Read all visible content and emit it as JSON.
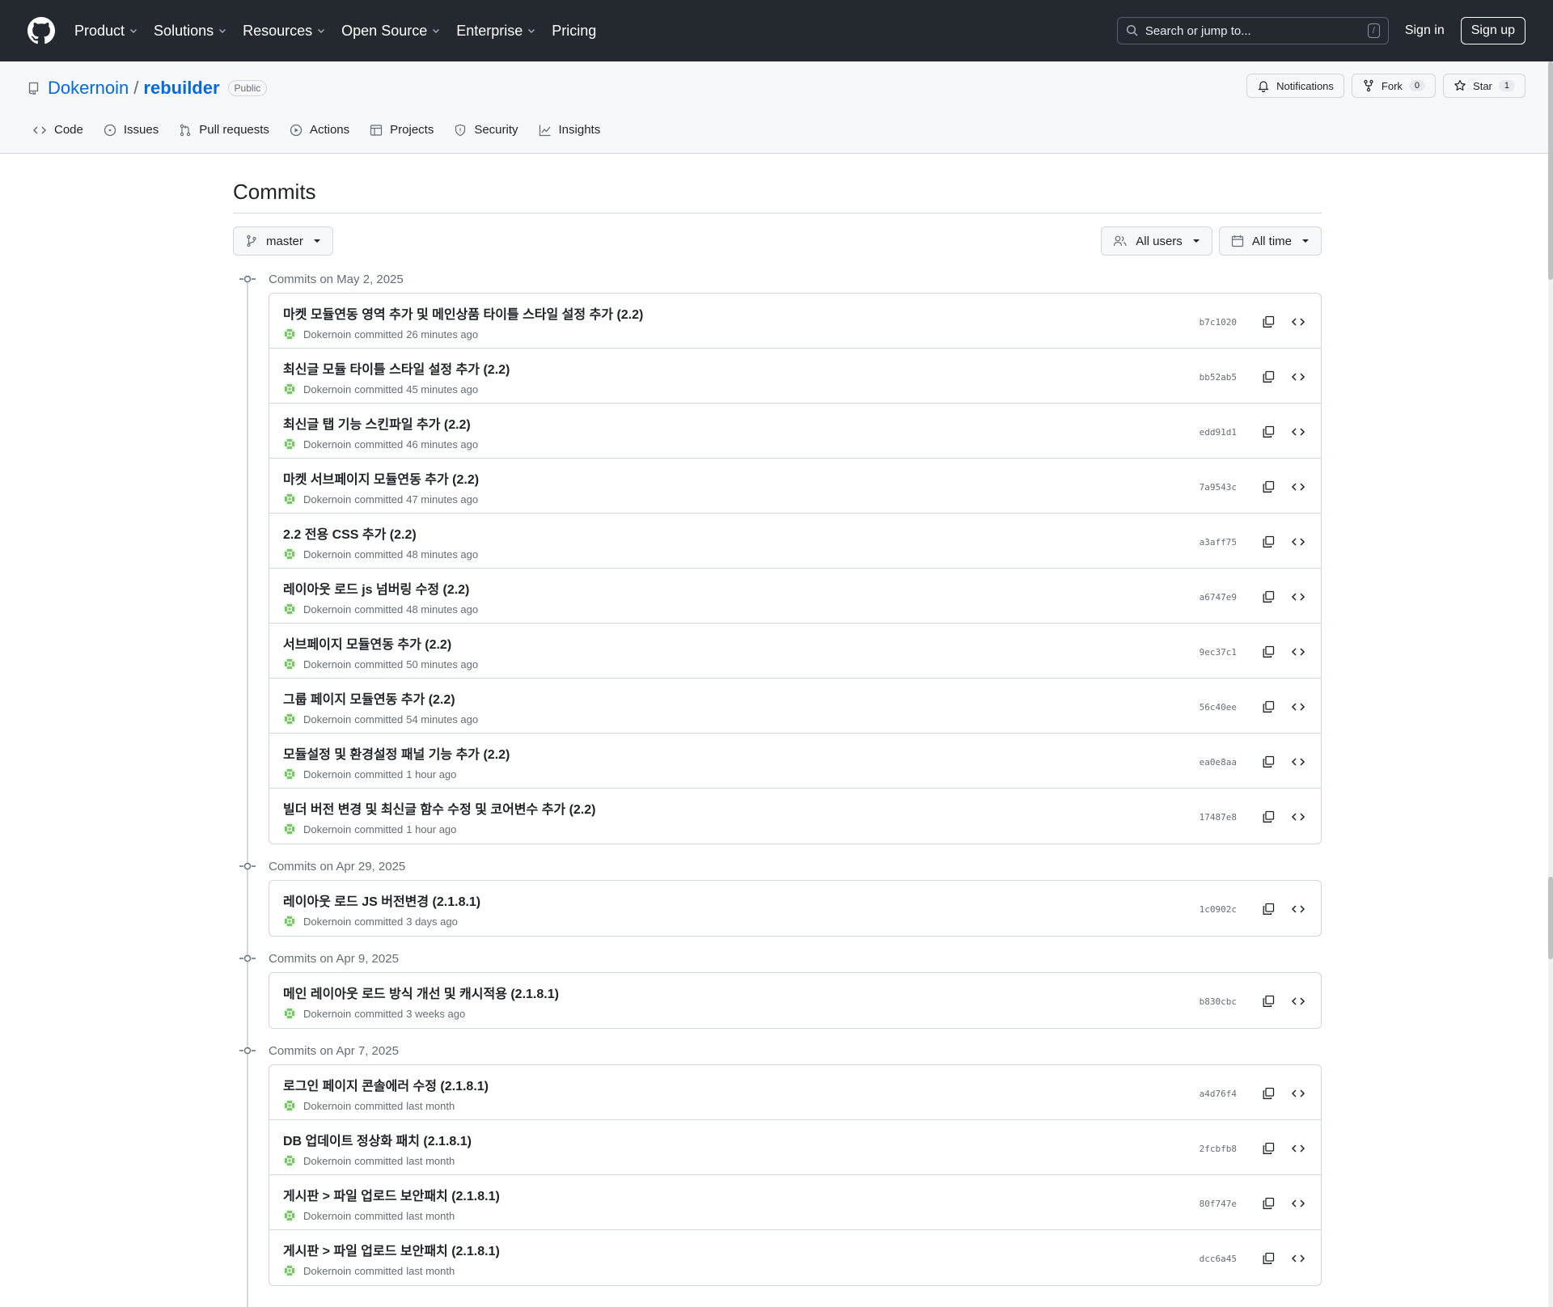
{
  "header": {
    "nav": [
      "Product",
      "Solutions",
      "Resources",
      "Open Source",
      "Enterprise",
      "Pricing"
    ],
    "search_placeholder": "Search or jump to...",
    "search_shortcut": "/",
    "sign_in": "Sign in",
    "sign_up": "Sign up"
  },
  "repo": {
    "owner": "Dokernoin",
    "separator": "/",
    "name": "rebuilder",
    "visibility": "Public",
    "notifications_label": "Notifications",
    "fork_label": "Fork",
    "fork_count": "0",
    "star_label": "Star",
    "star_count": "1",
    "tabs": [
      {
        "label": "Code",
        "icon": "code-icon"
      },
      {
        "label": "Issues",
        "icon": "issue-icon"
      },
      {
        "label": "Pull requests",
        "icon": "pull-request-icon"
      },
      {
        "label": "Actions",
        "icon": "play-icon"
      },
      {
        "label": "Projects",
        "icon": "table-icon"
      },
      {
        "label": "Security",
        "icon": "shield-icon"
      },
      {
        "label": "Insights",
        "icon": "graph-icon"
      }
    ]
  },
  "page": {
    "title": "Commits",
    "branch": "master",
    "users_filter": "All users",
    "time_filter": "All time"
  },
  "colors": {
    "header_bg": "#24292f",
    "link": "#0969da",
    "muted": "#656d76",
    "border": "#d0d7de"
  },
  "groups": [
    {
      "date": "Commits on May 2, 2025",
      "commits": [
        {
          "title": "마켓 모듈연동 영역 추가 및 메인상품 타이틀 스타일 설정 추가 (2.2)",
          "author": "Dokernoin",
          "action": "committed",
          "time": "26 minutes ago",
          "sha": "b7c1020"
        },
        {
          "title": "최신글 모듈 타이틀 스타일 설정 추가 (2.2)",
          "author": "Dokernoin",
          "action": "committed",
          "time": "45 minutes ago",
          "sha": "bb52ab5"
        },
        {
          "title": "최신글 탭 기능 스킨파일 추가 (2.2)",
          "author": "Dokernoin",
          "action": "committed",
          "time": "46 minutes ago",
          "sha": "edd91d1"
        },
        {
          "title": "마켓 서브페이지 모듈연동 추가 (2.2)",
          "author": "Dokernoin",
          "action": "committed",
          "time": "47 minutes ago",
          "sha": "7a9543c"
        },
        {
          "title": "2.2 전용 CSS 추가 (2.2)",
          "author": "Dokernoin",
          "action": "committed",
          "time": "48 minutes ago",
          "sha": "a3aff75"
        },
        {
          "title": "레이아웃 로드 js 넘버링 수정 (2.2)",
          "author": "Dokernoin",
          "action": "committed",
          "time": "48 minutes ago",
          "sha": "a6747e9"
        },
        {
          "title": "서브페이지 모듈연동 추가 (2.2)",
          "author": "Dokernoin",
          "action": "committed",
          "time": "50 minutes ago",
          "sha": "9ec37c1"
        },
        {
          "title": "그룹 페이지 모듈연동 추가 (2.2)",
          "author": "Dokernoin",
          "action": "committed",
          "time": "54 minutes ago",
          "sha": "56c40ee"
        },
        {
          "title": "모듈설정 및 환경설정 패널 기능 추가 (2.2)",
          "author": "Dokernoin",
          "action": "committed",
          "time": "1 hour ago",
          "sha": "ea0e8aa"
        },
        {
          "title": "빌더 버전 변경 및 최신글 함수 수정 및 코어변수 추가 (2.2)",
          "author": "Dokernoin",
          "action": "committed",
          "time": "1 hour ago",
          "sha": "17487e8"
        }
      ]
    },
    {
      "date": "Commits on Apr 29, 2025",
      "commits": [
        {
          "title": "레이아웃 로드 JS 버전변경 (2.1.8.1)",
          "author": "Dokernoin",
          "action": "committed",
          "time": "3 days ago",
          "sha": "1c0902c"
        }
      ]
    },
    {
      "date": "Commits on Apr 9, 2025",
      "commits": [
        {
          "title": "메인 레이아웃 로드 방식 개선 및 캐시적용 (2.1.8.1)",
          "author": "Dokernoin",
          "action": "committed",
          "time": "3 weeks ago",
          "sha": "b830cbc"
        }
      ]
    },
    {
      "date": "Commits on Apr 7, 2025",
      "commits": [
        {
          "title": "로그인 페이지 콘솔에러 수정 (2.1.8.1)",
          "author": "Dokernoin",
          "action": "committed",
          "time": "last month",
          "sha": "a4d76f4"
        },
        {
          "title": "DB 업데이트 정상화 패치 (2.1.8.1)",
          "author": "Dokernoin",
          "action": "committed",
          "time": "last month",
          "sha": "2fcbfb8"
        },
        {
          "title": "게시판 > 파일 업로드 보안패치 (2.1.8.1)",
          "author": "Dokernoin",
          "action": "committed",
          "time": "last month",
          "sha": "80f747e"
        },
        {
          "title": "게시판 > 파일 업로드 보안패치 (2.1.8.1)",
          "author": "Dokernoin",
          "action": "committed",
          "time": "last month",
          "sha": "dcc6a45"
        }
      ]
    }
  ]
}
